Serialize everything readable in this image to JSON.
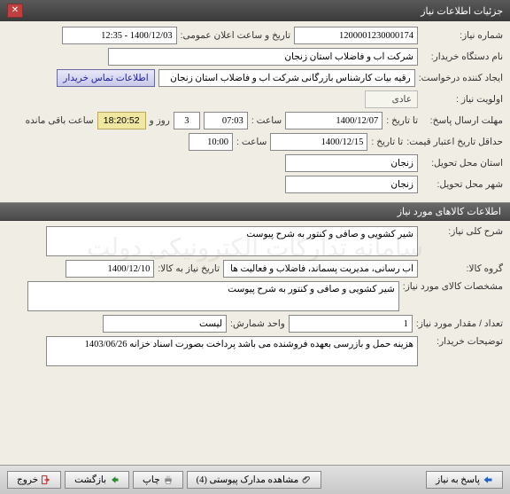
{
  "window": {
    "title": "جزئیات اطلاعات نیاز"
  },
  "section1": {
    "header": "",
    "need_no_label": "شماره نیاز:",
    "need_no": "1200001230000174",
    "announce_label": "تاریخ و ساعت اعلان عمومی:",
    "announce_value": "1400/12/03 - 12:35",
    "buyer_label": "نام دستگاه خریدار:",
    "buyer_value": "شرکت آب و فاضلاب استان زنجان",
    "requester_label": "ایجاد کننده درخواست:",
    "requester_value": "رقیه بیات کارشناس بازرگانی شرکت آب و فاضلاب استان زنجان",
    "contact_btn": "اطلاعات تماس خریدار",
    "priority_label": "اولویت نیاز :",
    "priority_value": "عادی",
    "deadline_send_label": "مهلت ارسال پاسخ:",
    "to_date_label": "تا تاریخ :",
    "deadline_date": "1400/12/07",
    "time_label": "ساعت :",
    "deadline_time": "07:03",
    "days_value": "3",
    "days_label": "روز و",
    "countdown": "18:20:52",
    "remain_label": "ساعت باقی مانده",
    "price_valid_label": "حداقل تاریخ اعتبار قیمت:",
    "price_valid_date": "1400/12/15",
    "price_valid_time": "10:00",
    "deliver_province_label": "استان محل تحویل:",
    "deliver_province": "زنجان",
    "deliver_city_label": "شهر محل تحویل:",
    "deliver_city": "زنجان"
  },
  "section2": {
    "header": "اطلاعات کالاهای مورد نیاز",
    "general_desc_label": "شرح کلی نیاز:",
    "general_desc": "شیر کشویی و صافی و کنتور به شرح پیوست",
    "group_label": "گروه کالا:",
    "group_value": "آب رسانی، مدیریت پسماند، فاضلاب و فعالیت ها",
    "need_date_label": "تاریخ نیاز به کالا:",
    "need_date": "1400/12/10",
    "spec_label": "مشخصات کالای مورد نیاز:",
    "spec_value": "شیر کشویی و صافی و کنتور به شرح پیوست",
    "qty_label": "تعداد / مقدار مورد نیاز:",
    "qty_value": "1",
    "unit_label": "واحد شمارش:",
    "unit_value": "لیست",
    "buyer_note_label": "توضیحات خریدار:",
    "buyer_note": "هزینه حمل و بازرسی بعهده فروشنده می باشد پرداخت بصورت اسناد خزانه 1403/06/26"
  },
  "footer": {
    "reply": "پاسخ به نیاز",
    "attach": "مشاهده مدارک پیوستی (4)",
    "print": "چاپ",
    "back": "بازگشت",
    "exit": "خروج"
  }
}
